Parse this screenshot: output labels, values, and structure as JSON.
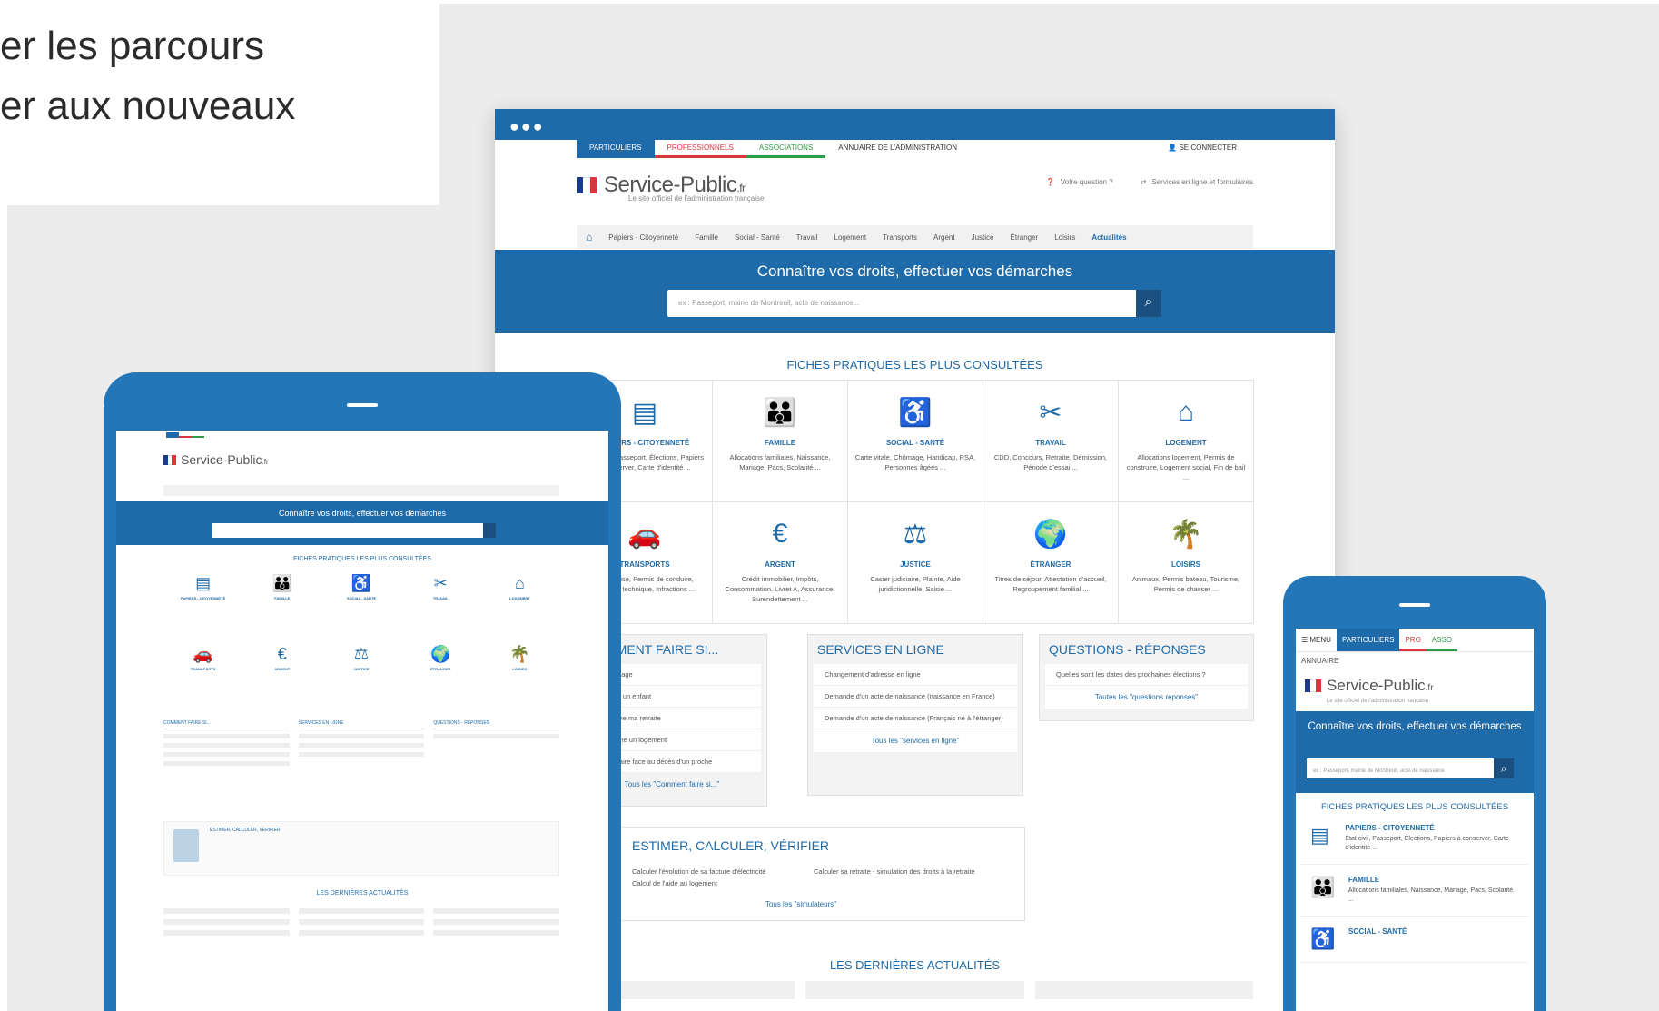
{
  "slide": {
    "line1": "er les parcours",
    "line2": "er aux nouveaux"
  },
  "desktop": {
    "tabs": [
      "PARTICULIERS",
      "PROFESSIONNELS",
      "ASSOCIATIONS",
      "ANNUAIRE DE L'ADMINISTRATION"
    ],
    "login": "SE CONNECTER",
    "logo": "Service-Public",
    "logo_suffix": ".fr",
    "tagline": "Le site officiel de l'administration française",
    "helper1": "Votre question ?",
    "helper2": "Services en ligne et formulaires",
    "nav": [
      "Papiers - Citoyenneté",
      "Famille",
      "Social - Santé",
      "Travail",
      "Logement",
      "Transports",
      "Argent",
      "Justice",
      "Étranger",
      "Loisirs",
      "Actualités"
    ],
    "hero_title": "Connaître vos droits, effectuer vos démarches",
    "search_placeholder": "ex : Passeport, mairie de Montreuil, acte de naissance...",
    "fiches_title": "FICHES PRATIQUES LES PLUS CONSULTÉES",
    "cards": [
      {
        "title": "PAPIERS - CITOYENNETÉ",
        "desc": "État civil, Passeport, Élections, Papiers à conserver, Carte d'identité ...",
        "icon": "id-card-icon",
        "glyph": "▤"
      },
      {
        "title": "FAMILLE",
        "desc": "Allocations familiales, Naissance, Mariage, Pacs, Scolarité ...",
        "icon": "family-icon",
        "glyph": "👪"
      },
      {
        "title": "SOCIAL - SANTÉ",
        "desc": "Carte vitale, Chômage, Handicap, RSA, Personnes âgées ...",
        "icon": "wheelchair-icon",
        "glyph": "♿"
      },
      {
        "title": "TRAVAIL",
        "desc": "CDD, Concours, Retraite, Démission, Période d'essai ...",
        "icon": "tools-icon",
        "glyph": "✂"
      },
      {
        "title": "LOGEMENT",
        "desc": "Allocations logement, Permis de construire, Logement social, Fin de bail ...",
        "icon": "house-icon",
        "glyph": "⌂"
      },
      {
        "title": "TRANSPORTS",
        "desc": "Carte grise, Permis de conduire, Contrôle technique, Infractions ...",
        "icon": "car-icon",
        "glyph": "🚗"
      },
      {
        "title": "ARGENT",
        "desc": "Crédit immobilier, Impôts, Consommation, Livret A, Assurance, Surendettement ...",
        "icon": "money-icon",
        "glyph": "€"
      },
      {
        "title": "JUSTICE",
        "desc": "Casier judiciaire, Plainte, Aide juridictionnelle, Saisie ...",
        "icon": "scales-icon",
        "glyph": "⚖"
      },
      {
        "title": "ÉTRANGER",
        "desc": "Titres de séjour, Attestation d'accueil, Regroupement familial ...",
        "icon": "globe-icon",
        "glyph": "🌍"
      },
      {
        "title": "LOISIRS",
        "desc": "Animaux, Permis bateau, Tourisme, Permis de chasser ...",
        "icon": "palm-icon",
        "glyph": "🌴"
      }
    ],
    "comment": {
      "title": "COMMENT FAIRE SI...",
      "items": [
        "J'emménage",
        "J'attends un enfant",
        "Je prépare ma retraite",
        "Je cherche un logement",
        "Je dois faire face au décès d'un proche"
      ],
      "more": "Tous les \"Comment faire si...\""
    },
    "services": {
      "title": "SERVICES EN LIGNE",
      "items": [
        "Changement d'adresse en ligne",
        "Demande d'un acte de naissance (naissance en France)",
        "Demande d'un acte de naissance (Français né à l'étranger)"
      ],
      "more": "Tous les \"services en ligne\""
    },
    "questions": {
      "title": "QUESTIONS - RÉPONSES",
      "items": [
        "Quelles sont les dates des prochaines élections ?"
      ],
      "more": "Toutes les \"questions réponses\""
    },
    "estimer": {
      "title": "ESTIMER, CALCULER, VÉRIFIER",
      "items": [
        "Calculer l'évolution de sa facture d'électricité",
        "Calcul de l'aide au logement",
        "Calculer sa retraite - simulation des droits à la retraite"
      ],
      "more": "Tous les \"simulateurs\""
    },
    "news_title": "LES DERNIÈRES ACTUALITÉS"
  },
  "tablet": {
    "logo": "Service-Public",
    "logo_suffix": ".fr",
    "hero_title": "Connaître vos droits, effectuer vos démarches",
    "fiches_title": "FICHES PRATIQUES LES PLUS CONSULTÉES",
    "col1": "COMMENT FAIRE SI...",
    "col2": "SERVICES EN LIGNE",
    "col3": "QUESTIONS - RÉPONSES",
    "estimer": "ESTIMER, CALCULER, VÉRIFIER",
    "news_title": "LES DERNIÈRES ACTUALITÉS"
  },
  "phone": {
    "menu": "☰ MENU",
    "tab_part": "PARTICULIERS",
    "tab_pro": "PRO",
    "tab_asso": "ASSO",
    "annuaire": "ANNUAIRE",
    "logo": "Service-Public",
    "logo_suffix": ".fr",
    "tagline": "Le site officiel de l'administration française",
    "hero_title": "Connaître vos droits, effectuer vos démarches",
    "search_placeholder": "ex : Passeport, mairie de Montreuil, acte de naissance",
    "fiches_title": "FICHES PRATIQUES LES PLUS CONSULTÉES",
    "items": [
      {
        "title": "PAPIERS - CITOYENNETÉ",
        "desc": "État civil, Passeport, Élections, Papiers à conserver, Carte d'identité ...",
        "glyph": "▤"
      },
      {
        "title": "FAMILLE",
        "desc": "Allocations familiales, Naissance, Mariage, Pacs, Scolarité ...",
        "glyph": "👪"
      },
      {
        "title": "SOCIAL - SANTÉ",
        "desc": "",
        "glyph": "♿"
      }
    ]
  }
}
